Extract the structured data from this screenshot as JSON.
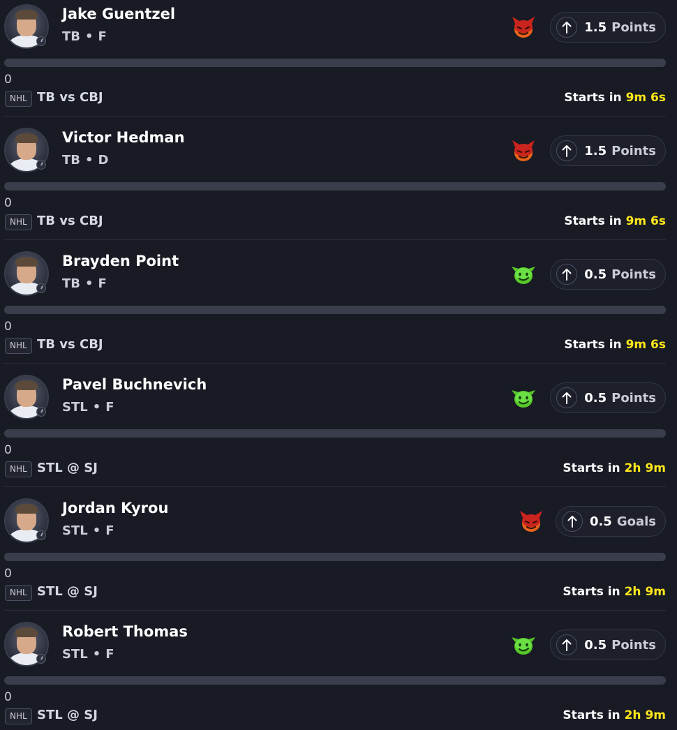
{
  "colors": {
    "background": "#181a24",
    "countdown": "#ffe81a",
    "goblin": "#6be045",
    "demon": "#d8322a"
  },
  "picks": [
    {
      "name": "Jake Guentzel",
      "team": "TB",
      "position": "F",
      "emoji": "demon-emoji-icon",
      "line": "1.5",
      "stat": "Points",
      "progress": 0,
      "progress_label": "0",
      "league": "NHL",
      "matchup": "TB vs CBJ",
      "starts_label": "Starts in",
      "starts_time": "9m 6s"
    },
    {
      "name": "Victor Hedman",
      "team": "TB",
      "position": "D",
      "emoji": "demon-emoji-icon",
      "line": "1.5",
      "stat": "Points",
      "progress": 0,
      "progress_label": "0",
      "league": "NHL",
      "matchup": "TB vs CBJ",
      "starts_label": "Starts in",
      "starts_time": "9m 6s"
    },
    {
      "name": "Brayden Point",
      "team": "TB",
      "position": "F",
      "emoji": "goblin-emoji-icon",
      "line": "0.5",
      "stat": "Points",
      "progress": 0,
      "progress_label": "0",
      "league": "NHL",
      "matchup": "TB vs CBJ",
      "starts_label": "Starts in",
      "starts_time": "9m 6s"
    },
    {
      "name": "Pavel Buchnevich",
      "team": "STL",
      "position": "F",
      "emoji": "goblin-emoji-icon",
      "line": "0.5",
      "stat": "Points",
      "progress": 0,
      "progress_label": "0",
      "league": "NHL",
      "matchup": "STL @ SJ",
      "starts_label": "Starts in",
      "starts_time": "2h 9m"
    },
    {
      "name": "Jordan Kyrou",
      "team": "STL",
      "position": "F",
      "emoji": "demon-emoji-icon",
      "line": "0.5",
      "stat": "Goals",
      "progress": 0,
      "progress_label": "0",
      "league": "NHL",
      "matchup": "STL @ SJ",
      "starts_label": "Starts in",
      "starts_time": "2h 9m"
    },
    {
      "name": "Robert Thomas",
      "team": "STL",
      "position": "F",
      "emoji": "goblin-emoji-icon",
      "line": "0.5",
      "stat": "Points",
      "progress": 0,
      "progress_label": "0",
      "league": "NHL",
      "matchup": "STL @ SJ",
      "starts_label": "Starts in",
      "starts_time": "2h 9m"
    }
  ]
}
